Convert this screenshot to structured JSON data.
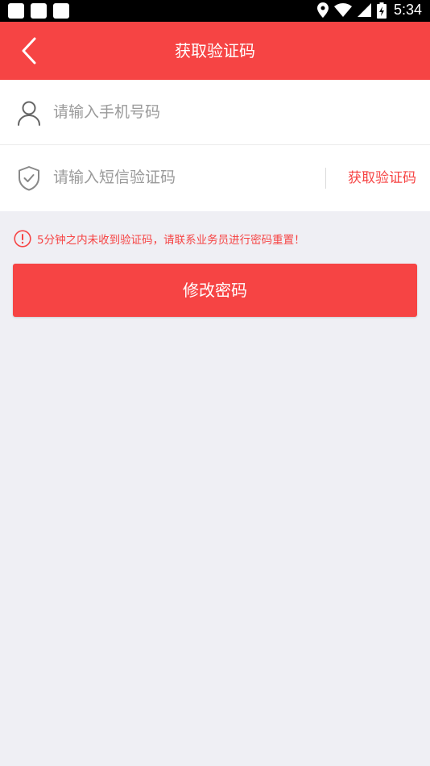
{
  "status_bar": {
    "time": "5:34",
    "notification_icons": [
      "notification-icon",
      "notification-icon",
      "notification-icon"
    ],
    "system_icons": [
      "location-icon",
      "wifi-icon",
      "signal-icon",
      "battery-charging-icon"
    ]
  },
  "header": {
    "back_icon": "back-arrow-icon",
    "title": "获取验证码"
  },
  "form": {
    "phone": {
      "icon": "user-icon",
      "value": "",
      "placeholder": "请输入手机号码"
    },
    "sms_code": {
      "icon": "shield-check-icon",
      "value": "",
      "placeholder": "请输入短信验证码",
      "get_code_label": "获取验证码"
    }
  },
  "notice": {
    "icon": "exclamation-circle-icon",
    "text": "5分钟之内未收到验证码，请联系业务员进行密码重置！"
  },
  "submit": {
    "label": "修改密码"
  },
  "colors": {
    "accent": "#f64444",
    "background": "#efeff4",
    "surface": "#ffffff",
    "placeholder": "#9a9a9a",
    "status_bar": "#000000"
  }
}
